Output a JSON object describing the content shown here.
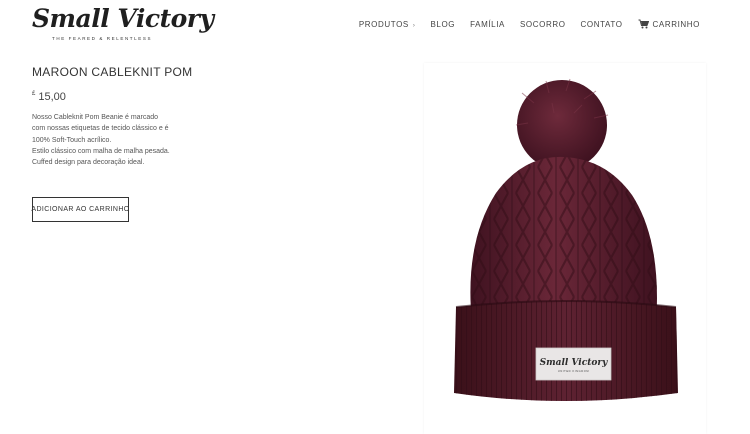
{
  "brand": {
    "name": "Small Victory",
    "tagline": "THE FEARED & RELENTLESS"
  },
  "nav": {
    "items": [
      {
        "label": "PRODUTOS",
        "has_dropdown": true
      },
      {
        "label": "BLOG"
      },
      {
        "label": "FAMÍLIA"
      },
      {
        "label": "SOCORRO"
      },
      {
        "label": "CONTATO"
      }
    ],
    "cart_label": "CARRINHO",
    "cart_icon": "cart-icon"
  },
  "product": {
    "title": "MAROON CABLEKNIT POM",
    "currency": "£",
    "price": "15,00",
    "description_lines": [
      "Nosso Cableknit Pom Beanie é marcado com nossas etiquetas de tecido clássico e é 100% Soft-Touch acrílico.",
      "Estilo clássico com malha de malha pesada.",
      "Cuffed design para decoração ideal."
    ],
    "add_to_cart_label": "ADICIONAR AO CARRINHO",
    "image": {
      "label_brand": "Small Victory",
      "label_sub": "UNITED KINGDOM",
      "colors": {
        "knit": "#5a1f2e",
        "knit_dark": "#3f1220",
        "knit_light": "#6e2a3b"
      }
    }
  }
}
